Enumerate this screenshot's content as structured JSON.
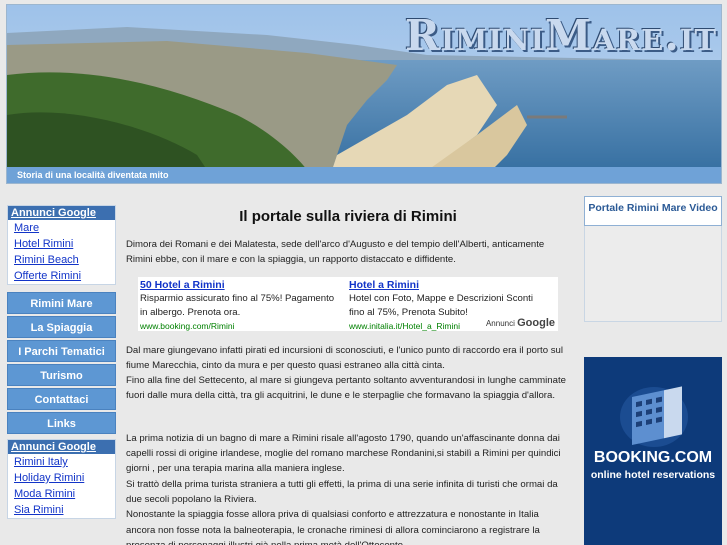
{
  "header": {
    "logo": "RiminiMare.it",
    "tagline": "Storia di una località diventata mito"
  },
  "sidebar": {
    "ads_top": {
      "title": "Annunci Google",
      "links": [
        "Mare",
        "Hotel Rimini",
        "Rimini Beach",
        "Offerte Rimini"
      ]
    },
    "nav": [
      "Rimini Mare",
      "La Spiaggia",
      "I Parchi Tematici",
      "Turismo",
      "Contattaci",
      "Links"
    ],
    "ads_bottom": {
      "title": "Annunci Google",
      "links": [
        "Rimini Italy",
        "Holiday Rimini",
        "Moda Rimini",
        "Sia Rimini"
      ]
    }
  },
  "main": {
    "title": "Il portale sulla riviera di Rimini",
    "intro": "Dimora dei  Romani e dei Malatesta, sede dell'arco d'Augusto e del tempio dell'Alberti, anticamente Rimini ebbe, con il mare e con la spiaggia, un rapporto distaccato e diffidente.",
    "ads": [
      {
        "title": "50 Hotel a Rimini",
        "text": "Risparmio assicurato fino al 75%! Pagamento in albergo. Prenota ora.",
        "url": "www.booking.com/Rimini"
      },
      {
        "title": "Hotel a Rimini",
        "text": "Hotel con Foto, Mappe e Descrizioni Sconti fino al 75%, Prenota Subito!",
        "url": "www.initalia.it/Hotel_a_Rimini"
      }
    ],
    "ads_badge_prefix": "Annunci",
    "ads_badge_brand": "Google",
    "para1": "Dal mare giungevano infatti  pirati ed incursioni di sconosciuti, e l'unico punto di raccordo era il porto sul fiume Marecchia, cinto da mura e per questo quasi estraneo alla città cinta.",
    "para2": "Fino alla fine del Settecento, al mare si giungeva pertanto soltanto avventurandosi in lunghe camminate fuori dalle mura della città, tra gli acquitrini, le dune e le sterpaglie che formavano la spiaggia d'allora.",
    "para3": "La prima notizia di un bagno di mare a Rimini risale all'agosto 1790, quando un'affascinante donna dai capelli rossi di origine irlandese, moglie del romano marchese Rondanini,si stabilì a Rimini per quindici giorni , per una terapia marina alla maniera inglese.",
    "para4": "Si trattò della prima turista straniera a tutti gli effetti, la prima di una serie infinita di turisti che ormai da due secoli popolano la  Riviera.",
    "para5": "Nonostante la spiaggia fosse allora priva di qualsiasi conforto e attrezzatura e nonostante in Italia ancora non fosse nota la balneoterapia, le cronache riminesi di allora cominciarono a registrare la presenza di personaggi illustri già nella prima metà dell'Ottocento."
  },
  "right": {
    "video_title": "Portale Rimini Mare Video",
    "booking_logo": "BOOKING.COM",
    "booking_sub": "online hotel reservations"
  }
}
